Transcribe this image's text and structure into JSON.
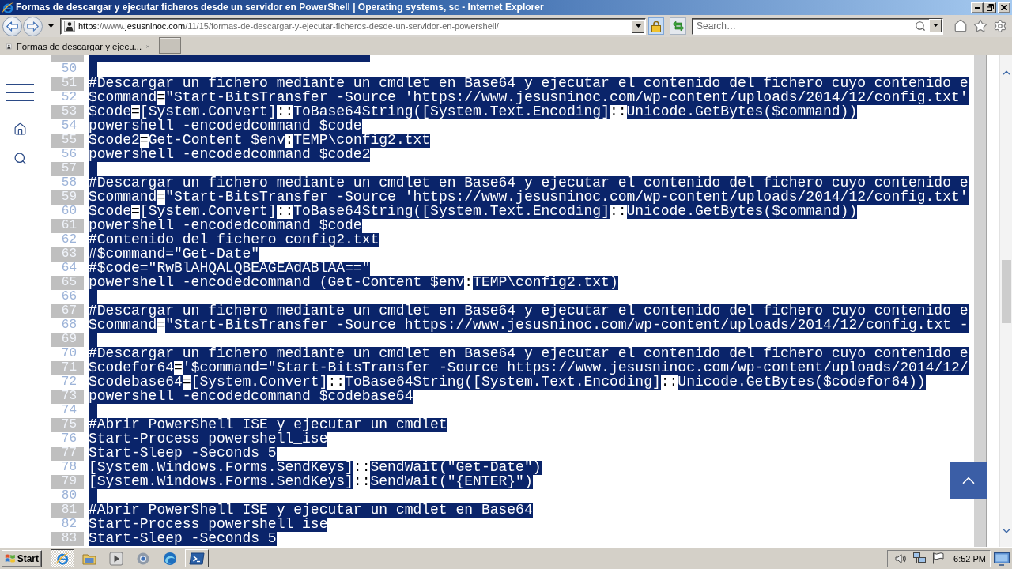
{
  "window": {
    "title": "Formas de descargar y ejecutar ficheros desde un servidor en PowerShell | Operating systems, sc - Internet Explorer"
  },
  "address_bar": {
    "url_parts": [
      {
        "text": "https",
        "dim": false
      },
      {
        "text": "://www.",
        "dim": true
      },
      {
        "text": "jesusninoc.com",
        "dim": false
      },
      {
        "text": "/11/15/formas-de-descargar-y-ejecutar-ficheros-desde-un-servidor-en-powershell/",
        "dim": true
      }
    ]
  },
  "search": {
    "placeholder": "Search…"
  },
  "tabs": [
    {
      "label": "Formas de descargar y ejecu...",
      "selected": true
    }
  ],
  "code": {
    "lines": [
      {
        "number": "50",
        "eol_selected": true
      },
      {
        "number": "51",
        "eol_selected": false,
        "segments": [
          {
            "text": "#Descargar un fichero mediante un cmdlet en Base64 y ejecutar el contenido del fichero cuyo contenido e",
            "selected": true
          }
        ]
      },
      {
        "number": "52",
        "eol_selected": false,
        "segments": [
          {
            "text": "$command",
            "selected": true
          },
          {
            "text": "=",
            "selected": false
          },
          {
            "text": "\"Start-BitsTransfer -Source 'https://www.jesusninoc.com/wp-content/uploads/2014/12/config.txt'",
            "selected": true
          }
        ]
      },
      {
        "number": "53",
        "eol_selected": false,
        "segments": [
          {
            "text": "$code",
            "selected": true
          },
          {
            "text": "=",
            "selected": false
          },
          {
            "text": "[System.Convert]",
            "selected": true
          },
          {
            "text": "::",
            "selected": false
          },
          {
            "text": "ToBase64String([System.Text.Encoding]",
            "selected": true
          },
          {
            "text": "::",
            "selected": false
          },
          {
            "text": "Unicode.GetBytes($command))",
            "selected": true
          }
        ]
      },
      {
        "number": "54",
        "eol_selected": false,
        "segments": [
          {
            "text": "powershell -encodedcommand $code",
            "selected": true
          }
        ]
      },
      {
        "number": "55",
        "eol_selected": false,
        "segments": [
          {
            "text": "$code2",
            "selected": true
          },
          {
            "text": "=",
            "selected": false
          },
          {
            "text": "Get-Content $env",
            "selected": true
          },
          {
            "text": ":",
            "selected": false
          },
          {
            "text": "TEMP\\config2.txt",
            "selected": true
          }
        ]
      },
      {
        "number": "56",
        "eol_selected": false,
        "segments": [
          {
            "text": "powershell -encodedcommand $code2",
            "selected": true
          }
        ]
      },
      {
        "number": "57",
        "eol_selected": true
      },
      {
        "number": "58",
        "eol_selected": false,
        "segments": [
          {
            "text": "#Descargar un fichero mediante un cmdlet en Base64 y ejecutar el contenido del fichero cuyo contenido e",
            "selected": true
          }
        ]
      },
      {
        "number": "59",
        "eol_selected": false,
        "segments": [
          {
            "text": "$command",
            "selected": true
          },
          {
            "text": "=",
            "selected": false
          },
          {
            "text": "\"Start-BitsTransfer -Source 'https://www.jesusninoc.com/wp-content/uploads/2014/12/config.txt'",
            "selected": true
          }
        ]
      },
      {
        "number": "60",
        "eol_selected": false,
        "segments": [
          {
            "text": "$code",
            "selected": true
          },
          {
            "text": "=",
            "selected": false
          },
          {
            "text": "[System.Convert]",
            "selected": true
          },
          {
            "text": "::",
            "selected": false
          },
          {
            "text": "ToBase64String([System.Text.Encoding]",
            "selected": true
          },
          {
            "text": "::",
            "selected": false
          },
          {
            "text": "Unicode.GetBytes($command))",
            "selected": true
          }
        ]
      },
      {
        "number": "61",
        "eol_selected": false,
        "segments": [
          {
            "text": "powershell -encodedcommand $code",
            "selected": true
          }
        ]
      },
      {
        "number": "62",
        "eol_selected": false,
        "segments": [
          {
            "text": "#Contenido del fichero config2.txt",
            "selected": true
          }
        ]
      },
      {
        "number": "63",
        "eol_selected": false,
        "segments": [
          {
            "text": "#$command=\"Get-Date\"",
            "selected": true
          }
        ]
      },
      {
        "number": "64",
        "eol_selected": false,
        "segments": [
          {
            "text": "#$code=\"RwBlAHQALQBEAGEAdABlAA==\"",
            "selected": true
          }
        ]
      },
      {
        "number": "65",
        "eol_selected": false,
        "segments": [
          {
            "text": "powershell -encodedcommand (Get-Content $env",
            "selected": true
          },
          {
            "text": ":",
            "selected": false
          },
          {
            "text": "TEMP\\config2.txt)",
            "selected": true
          }
        ]
      },
      {
        "number": "66",
        "eol_selected": true
      },
      {
        "number": "67",
        "eol_selected": false,
        "segments": [
          {
            "text": "#Descargar un fichero mediante un cmdlet en Base64 y ejecutar el contenido del fichero cuyo contenido e",
            "selected": true
          }
        ]
      },
      {
        "number": "68",
        "eol_selected": false,
        "segments": [
          {
            "text": "$command",
            "selected": true
          },
          {
            "text": "=",
            "selected": false
          },
          {
            "text": "\"Start-BitsTransfer -Source https://www.jesusninoc.com/wp-content/uploads/2014/12/config.txt -",
            "selected": true
          }
        ]
      },
      {
        "number": "69",
        "eol_selected": true
      },
      {
        "number": "70",
        "eol_selected": false,
        "segments": [
          {
            "text": "#Descargar un fichero mediante un cmdlet en Base64 y ejecutar el contenido del fichero cuyo contenido e",
            "selected": true
          }
        ]
      },
      {
        "number": "71",
        "eol_selected": false,
        "segments": [
          {
            "text": "$codefor64",
            "selected": true
          },
          {
            "text": "=",
            "selected": false
          },
          {
            "text": "'$command=\"Start-BitsTransfer -Source https://www.jesusninoc.com/wp-content/uploads/2014/12/",
            "selected": true
          }
        ]
      },
      {
        "number": "72",
        "eol_selected": false,
        "segments": [
          {
            "text": "$codebase64",
            "selected": true
          },
          {
            "text": "=",
            "selected": false
          },
          {
            "text": "[System.Convert]",
            "selected": true
          },
          {
            "text": "::",
            "selected": false
          },
          {
            "text": "ToBase64String([System.Text.Encoding]",
            "selected": true
          },
          {
            "text": "::",
            "selected": false
          },
          {
            "text": "Unicode.GetBytes($codefor64))",
            "selected": true
          }
        ]
      },
      {
        "number": "73",
        "eol_selected": false,
        "segments": [
          {
            "text": "powershell -encodedcommand $codebase64",
            "selected": true
          }
        ]
      },
      {
        "number": "74",
        "eol_selected": true
      },
      {
        "number": "75",
        "eol_selected": false,
        "segments": [
          {
            "text": "#Abrir PowerShell ISE y ejecutar un cmdlet",
            "selected": true
          }
        ]
      },
      {
        "number": "76",
        "eol_selected": false,
        "segments": [
          {
            "text": "Start-Process powershell_ise",
            "selected": true
          }
        ]
      },
      {
        "number": "77",
        "eol_selected": false,
        "segments": [
          {
            "text": "Start-Sleep -Seconds 5",
            "selected": true
          }
        ]
      },
      {
        "number": "78",
        "eol_selected": false,
        "segments": [
          {
            "text": "[System.Windows.Forms.SendKeys]",
            "selected": true
          },
          {
            "text": "::",
            "selected": false
          },
          {
            "text": "SendWait(\"Get-Date\")",
            "selected": true
          }
        ]
      },
      {
        "number": "79",
        "eol_selected": false,
        "segments": [
          {
            "text": "[System.Windows.Forms.SendKeys]",
            "selected": true
          },
          {
            "text": "::",
            "selected": false
          },
          {
            "text": "SendWait(\"{ENTER}\")",
            "selected": true
          }
        ]
      },
      {
        "number": "80",
        "eol_selected": true
      },
      {
        "number": "81",
        "eol_selected": false,
        "segments": [
          {
            "text": "#Abrir PowerShell ISE y ejecutar un cmdlet en Base64",
            "selected": true
          }
        ]
      },
      {
        "number": "82",
        "eol_selected": false,
        "segments": [
          {
            "text": "Start-Process powershell_ise",
            "selected": true
          }
        ]
      },
      {
        "number": "83",
        "eol_selected": false,
        "segments": [
          {
            "text": "Start-Sleep -Seconds 5",
            "selected": true
          }
        ]
      }
    ]
  },
  "taskbar": {
    "start_label": "Start",
    "items": [
      {
        "kind": "browser",
        "selected": true,
        "running": true
      },
      {
        "kind": "folder",
        "selected": false,
        "running": false
      },
      {
        "kind": "player",
        "selected": false,
        "running": false
      },
      {
        "kind": "ring",
        "selected": false,
        "running": false
      },
      {
        "kind": "wave",
        "selected": false,
        "running": false
      },
      {
        "kind": "terminal",
        "selected": false,
        "running": true
      }
    ],
    "clock": "6:52 PM"
  }
}
